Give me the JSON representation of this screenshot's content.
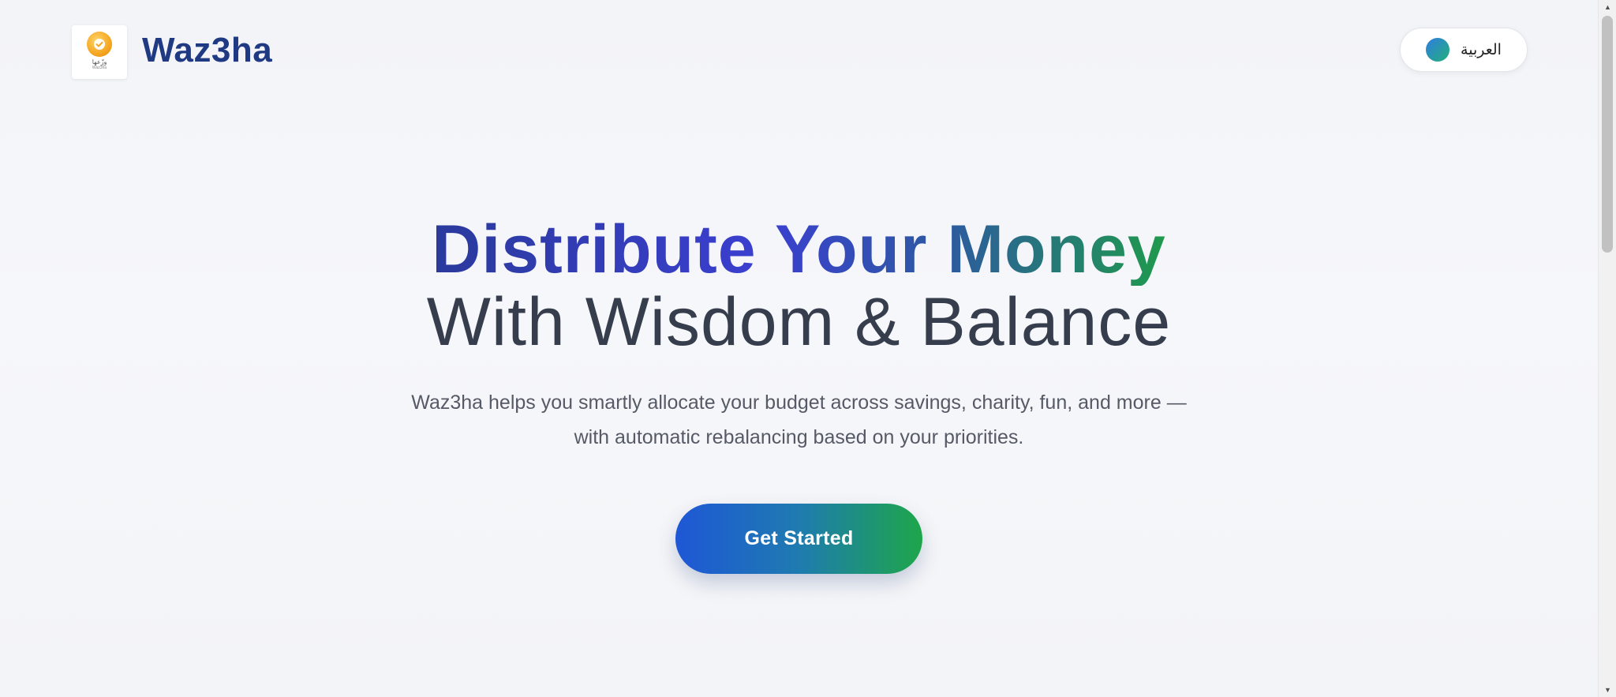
{
  "header": {
    "brand": "Waz3ha",
    "logo_text": "وزّعها",
    "logo_subtext": "Waz3ha",
    "language_button": "العربية"
  },
  "hero": {
    "title_line1": "Distribute Your Money",
    "title_line2": "With Wisdom & Balance",
    "subtitle_line1": "Waz3ha helps you smartly allocate your budget across savings, charity, fun, and more —",
    "subtitle_line2": "with automatic rebalancing based on your priorities.",
    "cta_label": "Get Started"
  },
  "colors": {
    "brand": "#1f3a82",
    "cta_start": "#1e57d6",
    "cta_end": "#1ea64a",
    "title_gradient_start": "#2a3a9c",
    "title_gradient_end": "#1f9a4c"
  },
  "icons": {
    "logo": "check-badge-icon",
    "language": "globe-icon"
  }
}
